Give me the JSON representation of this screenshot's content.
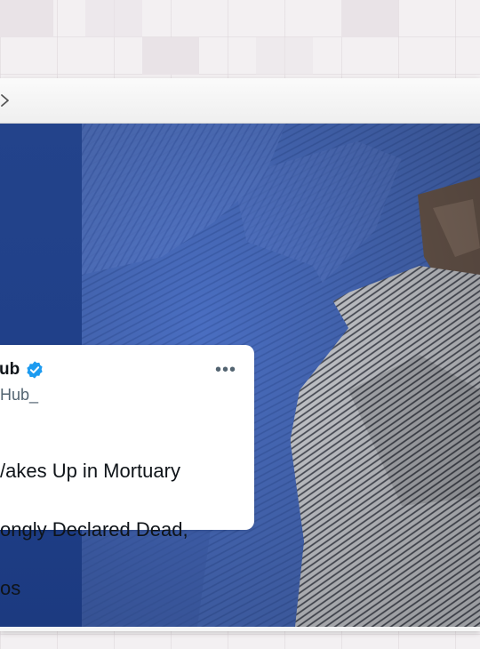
{
  "tweet": {
    "display_name": "ub",
    "handle": "Hub_",
    "more_label": "•••",
    "text_lines": [
      "/akes Up in Mortuary",
      "ongly Declared Dead,",
      "os"
    ]
  },
  "colors": {
    "verified": "#1d9bf0",
    "panel": "#21418a",
    "sheet": "#4b6fc0"
  },
  "icons": {
    "forward": "chevron-right-icon",
    "verified": "verified-badge-icon",
    "more": "more-options-icon"
  }
}
